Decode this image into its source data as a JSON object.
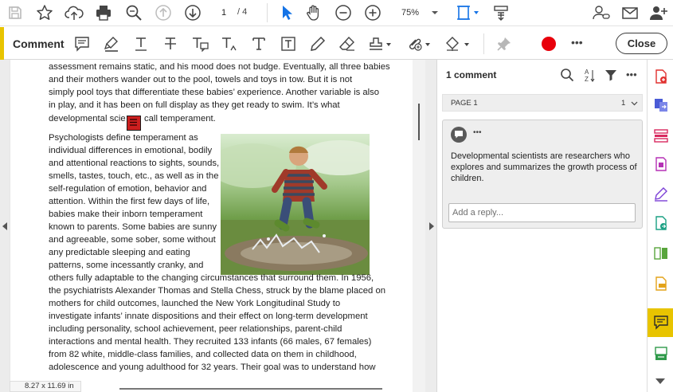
{
  "toolbar": {
    "page_current": "1",
    "page_total": "/ 4",
    "zoom": "75%"
  },
  "comment_bar": {
    "title": "Comment",
    "close_label": "Close",
    "more": "•••"
  },
  "document": {
    "para1": [
      "assessment remains static, and his mood does not budge. Eventually, all three babies",
      "and their mothers wander out to the pool, towels and toys in tow. But it is not",
      "simply pool toys that differentiate these babies’ experience. Another variable is also",
      "in play, and it has been on full display as they get ready to swim. It’s what"
    ],
    "line5_a": "developmental scie",
    "line5_b": "call temperament.",
    "para2": [
      "Psychologists define temperament as",
      "individual differences in emotional, bodily",
      "and attentional reactions to sights, sounds,",
      "smells, tastes, touch, etc., as well as in the",
      "self-regulation of emotion, behavior and",
      "attention. Within the first few days of life,",
      "babies make their inborn temperament",
      "known to parents. Some babies are sunny",
      "and agreeable, some sober, some without",
      "any predictable sleeping and eating",
      "patterns, some incessantly cranky, and"
    ],
    "para3": [
      "others fully adaptable to the changing circumstances that surround them. In 1956,",
      "the psychiatrists Alexander Thomas and Stella Chess, struck by the blame placed on",
      "mothers for child outcomes, launched the New York Longitudinal Study to",
      "investigate infants’ innate dispositions and their effect on long-term development",
      "including personality, school achievement, peer relationships, parent-child",
      "interactions and mental health. They recruited 133 infants (66 males, 67 females)",
      "from 82 white, middle-class families, and collected data on them in childhood,",
      "adolescence and young adulthood for 32 years. Their goal was to understand how"
    ],
    "page_size": "8.27 x 11.69 in"
  },
  "panel": {
    "count_label": "1 comment",
    "page_label": "PAGE 1",
    "page_count": "1",
    "comment_text": "Developmental scientists are researchers who explores and summarizes the growth process of children.",
    "reply_placeholder": "Add a reply...",
    "more": "•••"
  },
  "colors": {
    "accent_blue": "#1473e6",
    "highlight_yellow": "#e8c400",
    "record_red": "#e8000b",
    "note_red": "#cc1f1f"
  }
}
